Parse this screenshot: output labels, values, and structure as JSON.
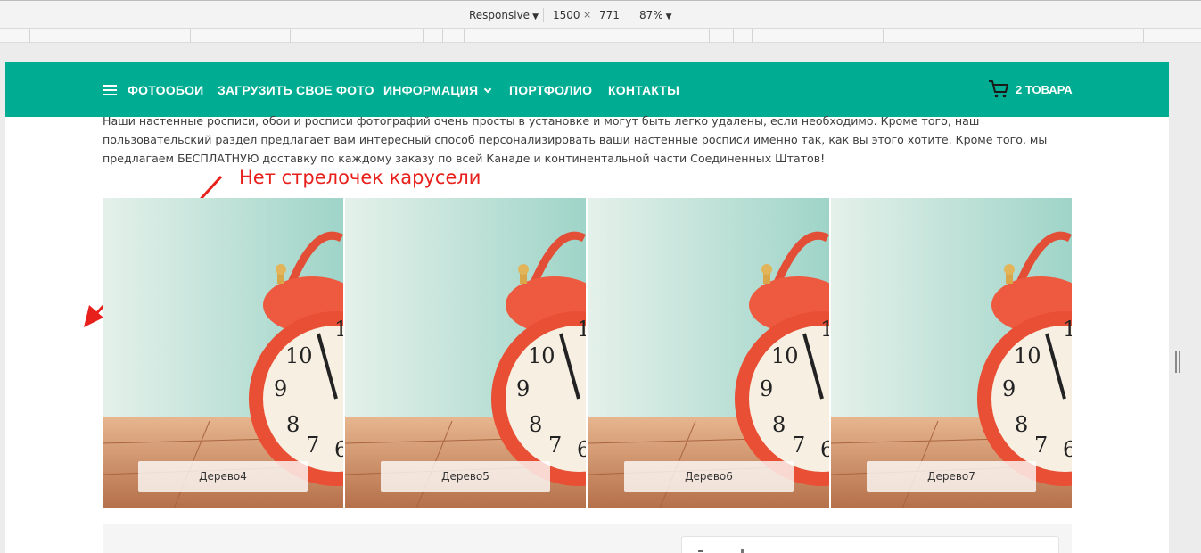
{
  "devtools": {
    "device": "Responsive",
    "width": "1500",
    "times": "×",
    "height": "771",
    "zoom": "87%"
  },
  "nav": {
    "items": [
      "ФОТООБОИ",
      "ЗАГРУЗИТЬ СВОЕ ФОТО",
      "ИНФОРМАЦИЯ",
      "ПОРТФОЛИО",
      "КОНТАКТЫ"
    ],
    "cart": "2 ТОВАРА",
    "bg_color": "#00ad93"
  },
  "intro": "Наши настенные росписи, обои и росписи фотографий очень просты в установке и могут быть легко удалены, если необходимо. Кроме того, наш пользовательский раздел предлагает вам интересный способ персонализировать ваши настенные росписи именно так, как вы этого хотите. Кроме того, мы предлагаем БЕСПЛАТНУЮ доставку по каждому заказу по всей Канаде и континентальной части Соединенных Штатов!",
  "annotation": {
    "text": "Нет стрелочек карусели",
    "color": "#e8201c"
  },
  "carousel": {
    "slides": [
      {
        "caption": "Дерево4"
      },
      {
        "caption": "Дерево5"
      },
      {
        "caption": "Дерево6"
      },
      {
        "caption": "Дерево7"
      }
    ]
  }
}
